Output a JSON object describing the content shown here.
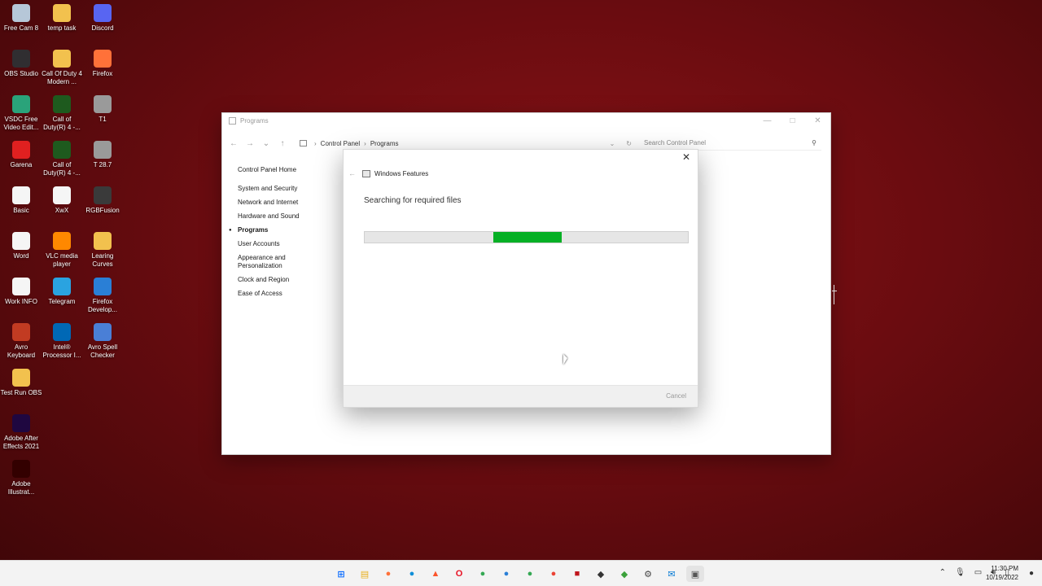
{
  "desktop": {
    "icons": [
      {
        "label": "Free Cam 8",
        "icon": "camera-icon",
        "color": "#b6c7d8"
      },
      {
        "label": "temp task",
        "icon": "folder-icon",
        "color": "#f2c14e"
      },
      {
        "label": "Discord",
        "icon": "discord-icon",
        "color": "#5865f2"
      },
      {
        "label": "OBS Studio",
        "icon": "obs-icon",
        "color": "#302e31"
      },
      {
        "label": "Call Of Duty 4 Modern ...",
        "icon": "folder-icon",
        "color": "#f2c14e"
      },
      {
        "label": "Firefox",
        "icon": "firefox-icon",
        "color": "#ff7139"
      },
      {
        "label": "VSDC Free Video Edit...",
        "icon": "vsdc-icon",
        "color": "#2aa37a"
      },
      {
        "label": "Call of Duty(R) 4 -...",
        "icon": "cod-icon",
        "color": "#1e5a1e"
      },
      {
        "label": "T1",
        "icon": "file-icon",
        "color": "#9a9a9a"
      },
      {
        "label": "Garena",
        "icon": "garena-icon",
        "color": "#e02020"
      },
      {
        "label": "Call of Duty(R) 4 -...",
        "icon": "cod-icon",
        "color": "#1e5a1e"
      },
      {
        "label": "T 28.7",
        "icon": "file-icon",
        "color": "#9a9a9a"
      },
      {
        "label": "Basic",
        "icon": "document-icon",
        "color": "#f5f5f5"
      },
      {
        "label": "XwX",
        "icon": "document-icon",
        "color": "#f5f5f5"
      },
      {
        "label": "RGBFusion",
        "icon": "rgbfusion-icon",
        "color": "#3a3a3a"
      },
      {
        "label": "Word",
        "icon": "document-icon",
        "color": "#f5f5f5"
      },
      {
        "label": "VLC media player",
        "icon": "vlc-icon",
        "color": "#ff8800"
      },
      {
        "label": "Learing Curves",
        "icon": "folder-icon",
        "color": "#f2c14e"
      },
      {
        "label": "Work INFO",
        "icon": "document-icon",
        "color": "#f5f5f5"
      },
      {
        "label": "Telegram",
        "icon": "telegram-icon",
        "color": "#2aa3e0"
      },
      {
        "label": "Firefox Develop...",
        "icon": "firefox-dev-icon",
        "color": "#2a7fd6"
      },
      {
        "label": "Avro Keyboard",
        "icon": "avro-icon",
        "color": "#c23b22"
      },
      {
        "label": "Intel® Processor I...",
        "icon": "intel-icon",
        "color": "#0068b5"
      },
      {
        "label": "Avro Spell Checker",
        "icon": "spellcheck-icon",
        "color": "#4a7fd6"
      },
      {
        "label": "Test Run OBS",
        "icon": "folder-icon",
        "color": "#f2c14e"
      },
      {
        "label": "Adobe After Effects 2021",
        "icon": "after-effects-icon",
        "color": "#1f0740"
      },
      {
        "label": "Adobe Illustrat...",
        "icon": "illustrator-icon",
        "color": "#330000"
      }
    ]
  },
  "control_panel": {
    "title": "Programs",
    "breadcrumb": [
      "Control Panel",
      "Programs"
    ],
    "search_placeholder": "Search Control Panel",
    "sidebar_home": "Control Panel Home",
    "sidebar_items": [
      {
        "label": "System and Security",
        "active": false
      },
      {
        "label": "Network and Internet",
        "active": false
      },
      {
        "label": "Hardware and Sound",
        "active": false
      },
      {
        "label": "Programs",
        "active": true
      },
      {
        "label": "User Accounts",
        "active": false
      },
      {
        "label": "Appearance and Personalization",
        "active": false
      },
      {
        "label": "Clock and Region",
        "active": false
      },
      {
        "label": "Ease of Access",
        "active": false
      }
    ]
  },
  "windows_features": {
    "title": "Windows Features",
    "status": "Searching for required files",
    "cancel_label": "Cancel",
    "progress_color": "#06b025"
  },
  "taskbar": {
    "apps": [
      {
        "icon": "start-icon",
        "glyph": "⊞",
        "color": "#0a6cff",
        "running": false
      },
      {
        "icon": "file-explorer-icon",
        "glyph": "▤",
        "color": "#e8b021",
        "running": false
      },
      {
        "icon": "firefox-icon",
        "glyph": "●",
        "color": "#ff7139",
        "running": false
      },
      {
        "icon": "edge-icon",
        "glyph": "●",
        "color": "#0f8fd8",
        "running": false
      },
      {
        "icon": "brave-icon",
        "glyph": "▲",
        "color": "#fb542b",
        "running": false
      },
      {
        "icon": "opera-icon",
        "glyph": "O",
        "color": "#e81224",
        "running": false
      },
      {
        "icon": "chrome-icon",
        "glyph": "●",
        "color": "#34a853",
        "running": false
      },
      {
        "icon": "firefox-dev-icon",
        "glyph": "●",
        "color": "#2a7fd6",
        "running": false
      },
      {
        "icon": "chrome-icon",
        "glyph": "●",
        "color": "#34a853",
        "running": false
      },
      {
        "icon": "chrome-icon",
        "glyph": "●",
        "color": "#ea4335",
        "running": false
      },
      {
        "icon": "app-red-icon",
        "glyph": "■",
        "color": "#c0151c",
        "running": false
      },
      {
        "icon": "app-dark-icon",
        "glyph": "◆",
        "color": "#333333",
        "running": false
      },
      {
        "icon": "app-green-icon",
        "glyph": "◆",
        "color": "#3aa13a",
        "running": false
      },
      {
        "icon": "settings-app-icon",
        "glyph": "⚙",
        "color": "#444444",
        "running": false
      },
      {
        "icon": "mail-icon",
        "glyph": "✉",
        "color": "#0078d4",
        "running": false
      },
      {
        "icon": "features-window-icon",
        "glyph": "▣",
        "color": "#555555",
        "running": true
      }
    ],
    "tray_icons": [
      "chevron-up-icon",
      "microphone-icon",
      "network-icon",
      "volume-icon",
      "battery-icon"
    ],
    "time": "11:30 PM",
    "date": "10/19/2022"
  }
}
